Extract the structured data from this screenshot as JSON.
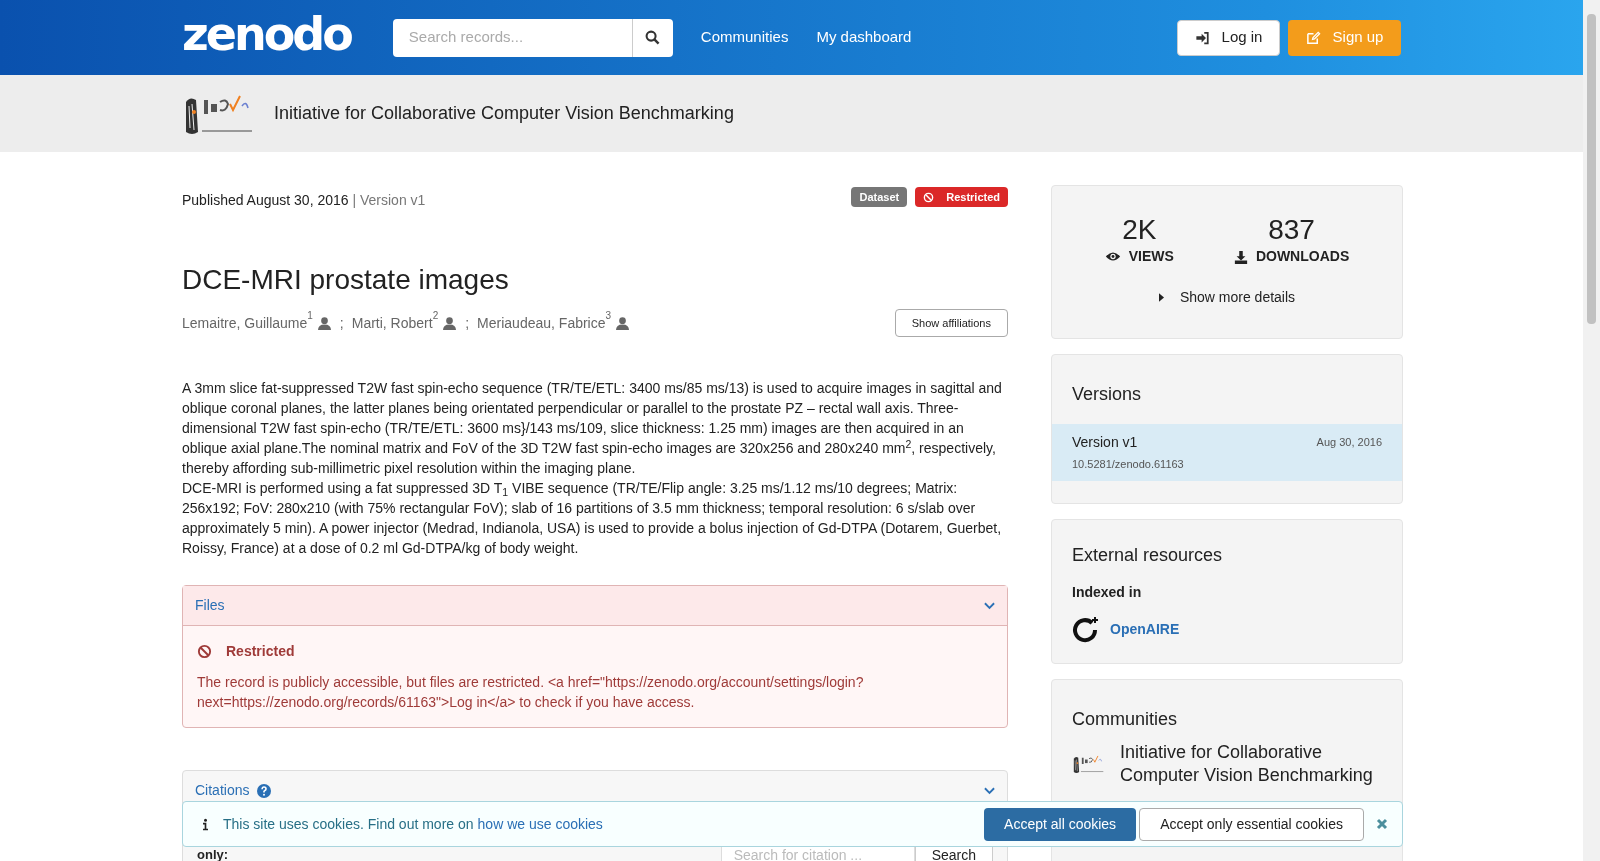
{
  "header": {
    "logo": "zenodo",
    "search": {
      "placeholder": "Search records..."
    },
    "nav": [
      "Communities",
      "My dashboard"
    ],
    "login": "Log in",
    "signup": "Sign up"
  },
  "community_bar": {
    "title": "Initiative for Collaborative Computer Vision Benchmarking"
  },
  "record": {
    "published": "Published August 30, 2016",
    "version": "| Version v1",
    "badges": [
      {
        "kind": "type",
        "label": "Dataset"
      },
      {
        "kind": "access",
        "label": "Restricted"
      }
    ],
    "title": "DCE-MRI prostate images",
    "authors": [
      {
        "name": "Lemaitre, Guillaume",
        "affiliation": "1"
      },
      {
        "name": "Marti, Robert",
        "affiliation": "2"
      },
      {
        "name": "Meriaudeau, Fabrice",
        "affiliation": "3"
      }
    ],
    "separator": ";",
    "show_affiliations": "Show affiliations",
    "description": [
      "A 3mm slice fat-suppressed T2W fast spin-echo sequence (TR/TE/ETL: 3400 ms/85 ms/13) is used to acquire images in sagittal and oblique coronal planes, the latter planes being orientated perpendicular or parallel to the prostate PZ – rectal wall axis. Three-dimensional T2W fast spin-echo (TR/TE/ETL: 3600 ms}/143 ms/109, slice thickness: 1.25 mm) images are then acquired in an oblique axial plane.The nominal matrix and FoV of the 3D T2W fast spin-echo images are 320x256 and 280x240 mm$^{2}$, respectively, thereby affording sub-millimetric pixel resolution within the imaging plane.",
      "DCE-MRI is performed using a fat suppressed 3D T$_{1}$ VIBE sequence (TR/TE/Flip angle: 3.25 ms/1.12 ms/10 degrees; Matrix: 256x192; FoV: 280x210 (with 75% rectangular FoV); slab of 16 partitions of 3.5 mm thickness; temporal resolution: 6 s/slab over approximately 5 min). A power injector (Medrad, Indianola, USA) is used to provide a bolus injection of Gd-DTPA (Dotarem, Guerbet, Roissy, France) at a dose of 0.2 ml Gd-DTPA/kg of body weight."
    ]
  },
  "files": {
    "title": "Files",
    "expanded": true,
    "notice_title": "Restricted",
    "notice_text": "The record is publicly accessible, but files are restricted. <a href=\"https://zenodo.org/account/settings/login?next=https://zenodo.org/records/61163\">Log in</a> to check if you have access."
  },
  "citations": {
    "title": "Citations",
    "filter_label": "only:",
    "search": {
      "placeholder": "Search for citation ..."
    },
    "search_button": "Search"
  },
  "stats": [
    {
      "value": "2K",
      "label": "VIEWS",
      "kind": "views"
    },
    {
      "value": "837",
      "label": "DOWNLOADS",
      "kind": "downloads"
    }
  ],
  "show_more": "Show more details",
  "versions": {
    "title": "Versions",
    "items": [
      {
        "name": "Version v1",
        "date": "Aug 30, 2016",
        "doi": "10.5281/zenodo.61163",
        "selected": true
      }
    ]
  },
  "external": {
    "title": "External resources",
    "subtitle": "Indexed in",
    "items": [
      "OpenAIRE"
    ]
  },
  "communities": {
    "title": "Communities",
    "items": [
      "Initiative for Collaborative Computer Vision Benchmarking"
    ]
  },
  "cookies": {
    "text": "This site uses cookies. Find out more on",
    "link": "how we use cookies",
    "accept_all": "Accept all cookies",
    "accept_essential": "Accept only essential cookies"
  }
}
